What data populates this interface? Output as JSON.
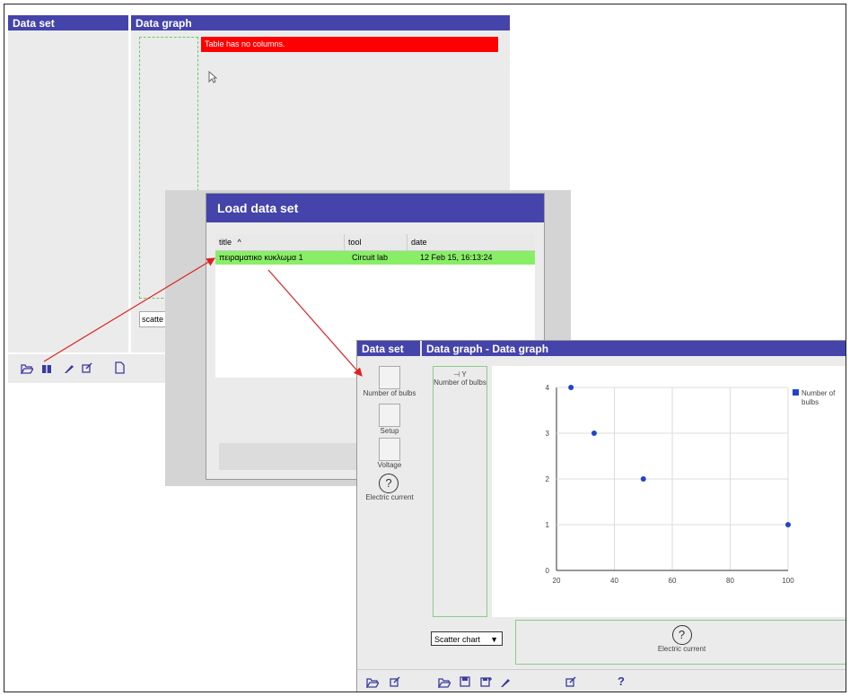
{
  "main": {
    "data_set_title": "Data set",
    "data_graph_title": "Data graph",
    "error_message": "Table has no columns.",
    "chart_type_value": "scatte"
  },
  "dialog": {
    "title": "Load data set",
    "columns": [
      "title",
      "tool",
      "date"
    ],
    "sort_indicator": "^",
    "rows": [
      {
        "title": "πειραματικο κυκλωμα 1",
        "tool": "Circuit lab",
        "date": "12 Feb 15, 16:13:24"
      }
    ]
  },
  "second": {
    "data_set_title": "Data set",
    "data_graph_title": "Data graph - Data graph",
    "variables": [
      {
        "label": "Number of bulbs"
      },
      {
        "label": "Setup"
      },
      {
        "label": "Voltage"
      },
      {
        "label": "Electric current"
      }
    ],
    "y_axis_slot_label": "Y",
    "y_variable_label": "Number of bulbs",
    "chart_type_select": "Scatter chart",
    "x_variable_label": "Electric current",
    "help_label": "?"
  },
  "chart_data": {
    "type": "scatter",
    "series": [
      {
        "name": "Number of bulbs",
        "x": [
          25,
          33,
          50,
          100
        ],
        "y": [
          4,
          3,
          2,
          1
        ]
      }
    ],
    "xlim": [
      20,
      100
    ],
    "ylim": [
      0,
      4
    ],
    "x_ticks": [
      "20",
      "40",
      "60",
      "80",
      "100"
    ],
    "y_ticks": [
      "0",
      "1",
      "2",
      "3",
      "4"
    ],
    "legend_position": "top-right",
    "grid": true,
    "color": "#2244cc"
  }
}
